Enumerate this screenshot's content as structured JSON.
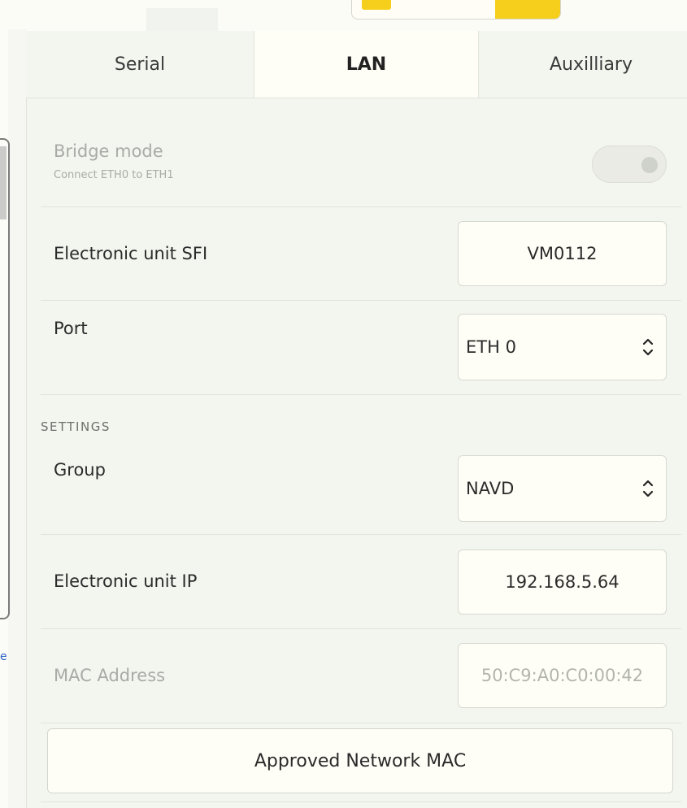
{
  "tabs": [
    {
      "label": "Serial"
    },
    {
      "label": "LAN"
    },
    {
      "label": "Auxilliary"
    }
  ],
  "active_tab": "LAN",
  "bridge_mode": {
    "label": "Bridge mode",
    "sub_label": "Connect ETH0 to ETH1",
    "enabled": false
  },
  "sfi": {
    "label": "Electronic unit SFI",
    "value": "VM0112"
  },
  "port": {
    "label": "Port",
    "value": "ETH 0"
  },
  "settings": {
    "heading": "SETTINGS"
  },
  "group": {
    "label": "Group",
    "value": "NAVD"
  },
  "ip": {
    "label": "Electronic unit IP",
    "value": "192.168.5.64"
  },
  "mac": {
    "label": "MAC Address",
    "value": "50:C9:A0:C0:00:42"
  },
  "approved_mac_button": {
    "label": "Approved Network MAC"
  },
  "edge_glyph": "e",
  "colors": {
    "accent_yellow": "#f5cf1b",
    "panel_bg": "#f3f5ef",
    "field_bg": "#fffef6"
  },
  "icons": {
    "select_chevron": "chevron-up-down-icon"
  }
}
